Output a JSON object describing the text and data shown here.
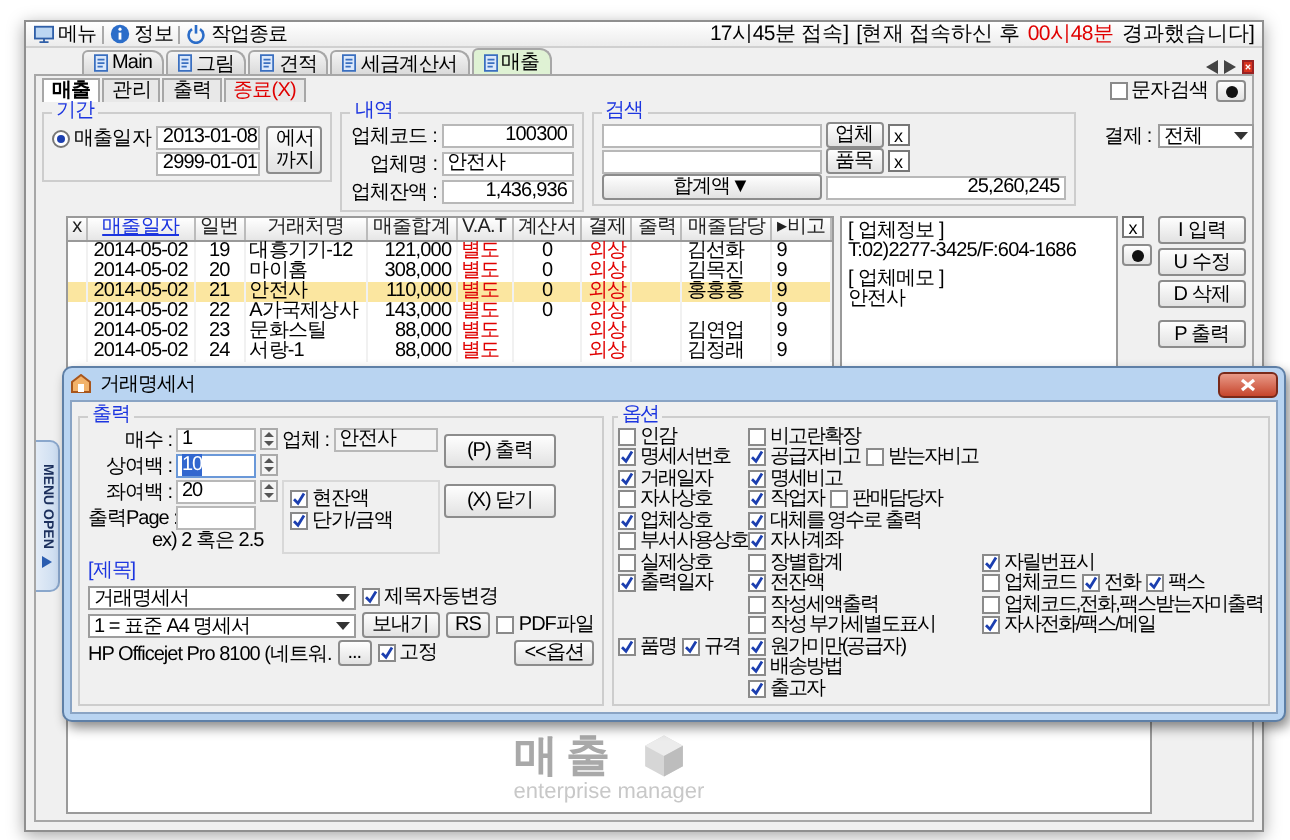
{
  "toolbar": {
    "items": [
      {
        "label": "메뉴"
      },
      {
        "label": "정보"
      },
      {
        "label": "작업종료"
      }
    ],
    "status": [
      "17시45분 접속]",
      "[현재 접속하신 후"
    ],
    "elapsed": "00시48분",
    "status_end": "경과했습니다]"
  },
  "tabs": [
    {
      "label": "Main",
      "selected": false
    },
    {
      "label": "그림",
      "selected": false
    },
    {
      "label": "견적",
      "selected": false
    },
    {
      "label": "세금계산서",
      "selected": false
    },
    {
      "label": "매출",
      "selected": true
    }
  ],
  "subtabs": [
    {
      "label": "매출",
      "selected": true,
      "kind": "normal"
    },
    {
      "label": "관리",
      "selected": false,
      "kind": "normal"
    },
    {
      "label": "출력",
      "selected": false,
      "kind": "normal"
    },
    {
      "label": "종료(X)",
      "selected": false,
      "kind": "danger"
    }
  ],
  "text_search": {
    "label": "문자검색",
    "checked": false
  },
  "period": {
    "title": "기간",
    "label": "매출일자",
    "selected": true,
    "from": "2013-01-08",
    "to": "2999-01-01",
    "button": "에서 까지"
  },
  "details": {
    "title": "내역",
    "fields": [
      {
        "label": "업체코드 :",
        "value": "100300"
      },
      {
        "label": "업체명 :",
        "value": "안전사"
      },
      {
        "label": "업체잔액 :",
        "value": "1,436,936"
      }
    ]
  },
  "search": {
    "title": "검색",
    "rows": [
      {
        "button": "업체",
        "clear": "x"
      },
      {
        "button": "품목",
        "clear": "x"
      }
    ],
    "total_button": "합계액▼",
    "total": "25,260,245"
  },
  "payment": {
    "label": "결제 :",
    "value": "전체"
  },
  "table": {
    "columns": [
      {
        "label": "x",
        "sorted": false
      },
      {
        "label": "매출일자",
        "sorted": true
      },
      {
        "label": "일번",
        "sorted": false
      },
      {
        "label": "거래처명",
        "sorted": false
      },
      {
        "label": "매출합계",
        "sorted": false
      },
      {
        "label": "V.A.T",
        "sorted": false
      },
      {
        "label": "계산서",
        "sorted": false
      },
      {
        "label": "결제",
        "sorted": false
      },
      {
        "label": "출력",
        "sorted": false
      },
      {
        "label": "매출담당",
        "sorted": false
      },
      {
        "label": "▸비고",
        "sorted": false
      }
    ],
    "rows": [
      {
        "date": "2014-05-02",
        "no": "19",
        "customer": "대흥기기-12",
        "total": "121,000",
        "vat": "별도",
        "invoice": "0",
        "payment": "외상",
        "manager": "김선화",
        "note": "9",
        "selected": false
      },
      {
        "date": "2014-05-02",
        "no": "20",
        "customer": "마이홈",
        "total": "308,000",
        "vat": "별도",
        "invoice": "0",
        "payment": "외상",
        "manager": "김목진",
        "note": "9",
        "selected": false
      },
      {
        "date": "2014-05-02",
        "no": "21",
        "customer": "안전사",
        "total": "110,000",
        "vat": "별도",
        "invoice": "0",
        "payment": "외상",
        "manager": "홍홍홍",
        "note": "9",
        "selected": true
      },
      {
        "date": "2014-05-02",
        "no": "22",
        "customer": "A가국제상사",
        "total": "143,000",
        "vat": "별도",
        "invoice": "0",
        "payment": "외상",
        "note": "9",
        "selected": false
      },
      {
        "date": "2014-05-02",
        "no": "23",
        "customer": "문화스틸",
        "total": "88,000",
        "vat": "별도",
        "payment": "외상",
        "manager": "김연업",
        "note": "9",
        "selected": false
      },
      {
        "date": "2014-05-02",
        "no": "24",
        "customer": "서랑-1",
        "total": "88,000",
        "vat": "별도",
        "payment": "외상",
        "manager": "김정래",
        "note": "9",
        "selected": false
      }
    ]
  },
  "info_panel": {
    "sections": [
      {
        "heading": "[ 업체정보 ]",
        "text": "T:02)2277-3425/F:604-1686"
      },
      {
        "heading": "[ 업체메모 ]",
        "text": "안전사"
      }
    ],
    "clear": "x"
  },
  "action_buttons": [
    "I 입력",
    "U 수정",
    "D 삭제",
    "P 출력"
  ],
  "side_tab": "MENU OPEN",
  "brand": {
    "title": "매출",
    "subtitle": "enterprise manager"
  },
  "dialog": {
    "title": "거래명세서",
    "output": {
      "title": "출력",
      "fields": [
        {
          "label": "매수 :",
          "value": "1",
          "focused": false
        },
        {
          "label": "상여백 :",
          "value": "10",
          "focused": true
        },
        {
          "label": "좌여백 :",
          "value": "20",
          "focused": false
        },
        {
          "label": "출력Page :",
          "focused": false
        }
      ],
      "hint": "ex) 2 혹은 2.5"
    },
    "company": {
      "label": "업체 :",
      "value": "안전사"
    },
    "buttons": [
      "(P) 출력",
      "(X) 닫기"
    ],
    "amount_checks": [
      {
        "label": "현잔액",
        "checked": true
      },
      {
        "label": "단가/금액",
        "checked": true
      }
    ],
    "title_section": {
      "title": "[제목]",
      "title_select": "거래명세서",
      "auto_title": {
        "label": "제목자동변경",
        "checked": true
      },
      "form_select": "1 = 표준 A4 명세서",
      "send_button": "보내기",
      "rs_button": "RS",
      "pdf": {
        "label": "PDF파일",
        "checked": false
      },
      "printer": "HP Officejet Pro 8100 (네트워.",
      "browse_button": "...",
      "fixed": {
        "label": "고정",
        "checked": true
      },
      "options_button": "<<옵션"
    },
    "options": {
      "title": "옵션",
      "rows": [
        {
          "left": [
            {
              "label": "인감",
              "checked": false
            }
          ],
          "middle": [
            {
              "label": "비고란확장",
              "checked": false
            }
          ]
        },
        {
          "left": [
            {
              "label": "명세서번호",
              "checked": true
            }
          ],
          "middle": [
            {
              "label": "공급자비고",
              "checked": true
            },
            {
              "label": "받는자비고",
              "checked": false
            }
          ]
        },
        {
          "left": [
            {
              "label": "거래일자",
              "checked": true
            }
          ],
          "middle": [
            {
              "label": "명세비고",
              "checked": true
            }
          ]
        },
        {
          "left": [
            {
              "label": "자사상호",
              "checked": false
            }
          ],
          "middle": [
            {
              "label": "작업자",
              "checked": true
            },
            {
              "label": "판매담당자",
              "checked": false
            }
          ]
        },
        {
          "left": [
            {
              "label": "업체상호",
              "checked": true
            }
          ],
          "middle": [
            {
              "label": "대체를 영수로 출력",
              "checked": true
            }
          ]
        },
        {
          "left": [
            {
              "label": "부서사용상호",
              "checked": false
            }
          ],
          "middle": [
            {
              "label": "자사계좌",
              "checked": true
            }
          ]
        },
        {
          "left": [
            {
              "label": "실제상호",
              "checked": false
            }
          ],
          "middle": [
            {
              "label": "장별합계",
              "checked": false
            }
          ],
          "right": [
            {
              "label": "자릴번표시",
              "checked": true
            }
          ]
        },
        {
          "left": [
            {
              "label": "출력일자",
              "checked": true
            }
          ],
          "middle": [
            {
              "label": "전잔액",
              "checked": true
            }
          ],
          "right": [
            {
              "label": "업체코드",
              "checked": false
            },
            {
              "label": "전화",
              "checked": true
            },
            {
              "label": "팩스",
              "checked": true
            }
          ]
        },
        {
          "middle": [
            {
              "label": "작성세액출력",
              "checked": false
            }
          ],
          "right": [
            {
              "label": "업체코드,전화,팩스받는자미출력",
              "checked": false
            }
          ]
        },
        {
          "middle": [
            {
              "label": "작성 부가세별도표시",
              "checked": false
            }
          ],
          "right": [
            {
              "label": "자사전화/팩스/메일",
              "checked": true
            }
          ]
        },
        {
          "left": [
            {
              "label": "품명",
              "checked": true
            },
            {
              "label": "규격",
              "checked": true
            }
          ],
          "middle": [
            {
              "label": "원가미만(공급자)",
              "checked": true
            }
          ]
        },
        {
          "middle": [
            {
              "label": "배송방법",
              "checked": true
            }
          ]
        },
        {
          "middle": [
            {
              "label": "출고자",
              "checked": true
            }
          ]
        }
      ]
    }
  }
}
